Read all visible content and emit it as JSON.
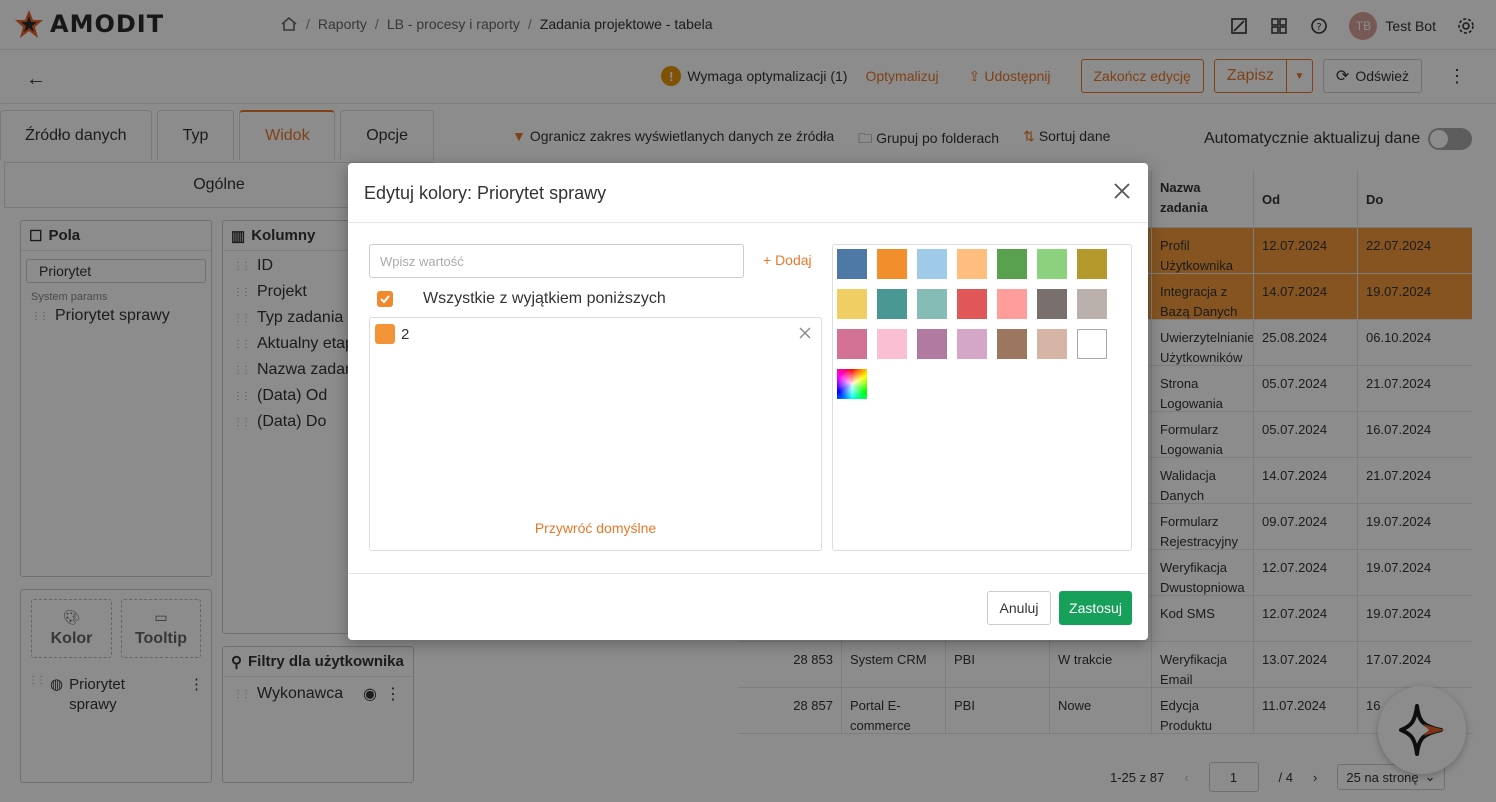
{
  "brand": {
    "name": "AMODIT"
  },
  "breadcrumb": {
    "items": [
      "Raporty",
      "LB - procesy i raporty"
    ],
    "current": "Zadania projektowe - tabela"
  },
  "user": {
    "initials": "TB",
    "name": "Test Bot"
  },
  "actionbar": {
    "warning_text": "Wymaga optymalizacji (1)",
    "optimize_label": "Optymalizuj",
    "share_label": "Udostępnij",
    "finish_edit_label": "Zakończ edycję",
    "save_label": "Zapisz",
    "refresh_label": "Odśwież"
  },
  "left_tabs": [
    "Źródło danych",
    "Typ",
    "Widok",
    "Opcje"
  ],
  "general_label": "Ogólne",
  "fields_panel": {
    "title": "Pola",
    "search_value": "Priorytet",
    "section_label": "System params",
    "items": [
      "Priorytet sprawy"
    ]
  },
  "columns_panel": {
    "title": "Kolumny",
    "items": [
      "ID",
      "Projekt",
      "Typ zadania",
      "Aktualny etap",
      "Nazwa zadania",
      "(Data) Od",
      "(Data) Do"
    ]
  },
  "color_box": {
    "label": "Kolor"
  },
  "tooltip_box": {
    "label": "Tooltip"
  },
  "color_field": {
    "label": "Priorytet sprawy"
  },
  "user_filters": {
    "title": "Filtry dla użytkownika",
    "items": [
      "Wykonawca"
    ]
  },
  "toolbar2": {
    "limit_label": "Ogranicz zakres wyświetlanych danych ze źródła",
    "group_label": "Grupuj po folderach",
    "sort_label": "Sortuj dane",
    "auto_update_label": "Automatycznie aktualizuj dane"
  },
  "grid": {
    "headers": [
      "Nazwa zadania",
      "Od",
      "Do"
    ],
    "rows": [
      {
        "id": "",
        "proj": "",
        "typ": "",
        "etap": "",
        "name": "Profil Użytkownika",
        "od": "12.07.2024",
        "do": "22.07.2024",
        "hl": true
      },
      {
        "id": "",
        "proj": "",
        "typ": "",
        "etap": "",
        "name": "Integracja z Bazą Danych",
        "od": "14.07.2024",
        "do": "19.07.2024",
        "hl": true
      },
      {
        "id": "",
        "proj": "",
        "typ": "",
        "etap": "",
        "name": "Uwierzytelnianie Użytkowników",
        "od": "25.08.2024",
        "do": "06.10.2024",
        "hl": false
      },
      {
        "id": "",
        "proj": "",
        "typ": "",
        "etap": "",
        "name": "Strona Logowania",
        "od": "05.07.2024",
        "do": "21.07.2024",
        "hl": false
      },
      {
        "id": "",
        "proj": "",
        "typ": "",
        "etap": "",
        "name": "Formularz Logowania",
        "od": "05.07.2024",
        "do": "16.07.2024",
        "hl": false
      },
      {
        "id": "",
        "proj": "",
        "typ": "",
        "etap": "",
        "name": "Walidacja Danych Logowania",
        "od": "14.07.2024",
        "do": "21.07.2024",
        "hl": false
      },
      {
        "id": "",
        "proj": "",
        "typ": "",
        "etap": "",
        "name": "Formularz Rejestracyjny",
        "od": "09.07.2024",
        "do": "19.07.2024",
        "hl": false
      },
      {
        "id": "",
        "proj": "",
        "typ": "",
        "etap": "",
        "name": "Weryfikacja Dwustopniowa",
        "od": "12.07.2024",
        "do": "19.07.2024",
        "hl": false
      },
      {
        "id": "",
        "proj": "",
        "typ": "",
        "etap": "",
        "name": "Kod SMS",
        "od": "12.07.2024",
        "do": "19.07.2024",
        "hl": false
      },
      {
        "id": "28 853",
        "proj": "System CRM",
        "typ": "PBI",
        "etap": "W trakcie",
        "name": "Weryfikacja Email",
        "od": "13.07.2024",
        "do": "17.07.2024",
        "hl": false
      },
      {
        "id": "28 857",
        "proj": "Portal E-commerce",
        "typ": "PBI",
        "etap": "Nowe",
        "name": "Edycja Produktu",
        "od": "11.07.2024",
        "do": "16",
        "hl": false
      }
    ]
  },
  "pager": {
    "range": "1-25 z 87",
    "page": "1",
    "total": "/ 4",
    "per_page": "25 na stronę"
  },
  "modal": {
    "title": "Edytuj kolory: Priorytet sprawy",
    "input_placeholder": "Wpisz wartość",
    "add_label": "+ Dodaj",
    "all_except_label": "Wszystkie z wyjątkiem poniższych",
    "values": [
      {
        "label": "2",
        "color": "#f29338"
      }
    ],
    "restore_label": "Przywróć domyślne",
    "palette": [
      "#4e79a7",
      "#f28e2b",
      "#a0cbe8",
      "#ffbe7d",
      "#59a14f",
      "#8cd17d",
      "#b6992d",
      "#f1ce63",
      "#499894",
      "#86bcb6",
      "#e15759",
      "#ff9d9a",
      "#79706e",
      "#bab0ac",
      "#d37295",
      "#fabfd2",
      "#b07aa1",
      "#d4a6c8",
      "#9d7660",
      "#d7b5a6",
      "#ffffff"
    ],
    "cancel_label": "Anuluj",
    "apply_label": "Zastosuj"
  }
}
